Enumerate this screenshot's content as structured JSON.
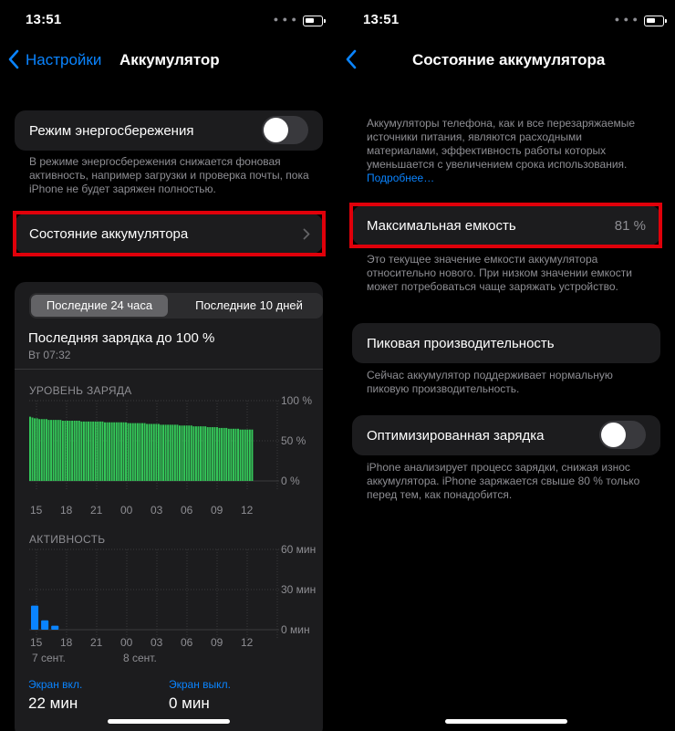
{
  "left": {
    "status": {
      "time": "13:51"
    },
    "nav": {
      "back_label": "Настройки",
      "title": "Аккумулятор"
    },
    "low_power": {
      "label": "Режим энергосбережения",
      "enabled": false,
      "footnote": "В режиме энергосбережения снижается фоновая активность, например загрузки и проверка почты, пока iPhone не будет заряжен полностью."
    },
    "battery_health_row": {
      "label": "Состояние аккумулятора"
    },
    "usage": {
      "tabs": [
        {
          "label": "Последние 24 часа",
          "active": true
        },
        {
          "label": "Последние 10 дней",
          "active": false
        }
      ],
      "last_charge": {
        "title": "Последняя зарядка до 100 %",
        "time": "Вт 07:32"
      },
      "activity_summary": {
        "screen_on_label": "Экран вкл.",
        "screen_on_value": "22 мин",
        "screen_off_label": "Экран выкл.",
        "screen_off_value": "0 мин"
      }
    },
    "colors": {
      "accent": "#0a84ff",
      "battery_green": "#34c759",
      "activity_blue": "#0a84ff",
      "highlight": "#e0000a"
    }
  },
  "right": {
    "status": {
      "time": "13:51"
    },
    "nav": {
      "title": "Состояние аккумулятора"
    },
    "intro": {
      "text": "Аккумуляторы телефона, как и все перезаряжаемые источники питания, являются расходными материалами, эффективность работы которых уменьшается с увеличением срока использования.",
      "link": "Подробнее…"
    },
    "max_capacity": {
      "label": "Максимальная емкость",
      "value": "81 %",
      "footnote": "Это текущее значение емкости аккумулятора относительно нового. При низком значении емкости может потребоваться чаще заряжать устройство."
    },
    "peak_performance": {
      "label": "Пиковая производительность",
      "footnote": "Сейчас аккумулятор поддерживает нормальную пиковую производительность."
    },
    "optimized_charging": {
      "label": "Оптимизированная зарядка",
      "enabled": false,
      "footnote": "iPhone анализирует процесс зарядки, снижая износ аккумулятора. iPhone заряжается свыше 80 % только перед тем, как понадобится."
    }
  },
  "chart_data": [
    {
      "type": "bar",
      "title": "УРОВЕНЬ ЗАРЯДА",
      "categories": [
        "15",
        "18",
        "21",
        "00",
        "03",
        "06",
        "09",
        "12"
      ],
      "y_ticks": [
        "100 %",
        "50 %",
        "0 %"
      ],
      "ylim": [
        0,
        100
      ],
      "values": [
        80,
        79,
        78,
        78,
        77,
        77,
        77,
        77,
        76,
        76,
        76,
        76,
        76,
        76,
        75,
        75,
        75,
        75,
        75,
        75,
        75,
        75,
        74,
        74,
        74,
        74,
        74,
        74,
        74,
        74,
        74,
        74,
        73,
        73,
        73,
        73,
        73,
        73,
        73,
        73,
        73,
        73,
        72,
        72,
        72,
        72,
        72,
        72,
        72,
        72,
        71,
        71,
        71,
        71,
        71,
        71,
        70,
        70,
        70,
        70,
        70,
        70,
        70,
        70,
        69,
        69,
        69,
        69,
        69,
        69,
        68,
        68,
        68,
        68,
        68,
        68,
        67,
        67,
        67,
        67,
        67,
        66,
        66,
        66,
        66,
        65,
        65,
        65,
        65,
        65,
        64,
        64,
        64,
        64,
        64,
        64
      ]
    },
    {
      "type": "bar",
      "title": "АКТИВНОСТЬ",
      "categories": [
        "15",
        "18",
        "21",
        "00",
        "03",
        "06",
        "09",
        "12"
      ],
      "date_labels": [
        "7 сент.",
        "8 сент."
      ],
      "y_ticks": [
        "60 мин",
        "30 мин",
        "0 мин"
      ],
      "ylim": [
        0,
        60
      ],
      "values": [
        18,
        7,
        3,
        0,
        0,
        0,
        0,
        0,
        0,
        0,
        0,
        0,
        0,
        0,
        0,
        0,
        0,
        0,
        0,
        0,
        0,
        0,
        0,
        0
      ]
    }
  ]
}
